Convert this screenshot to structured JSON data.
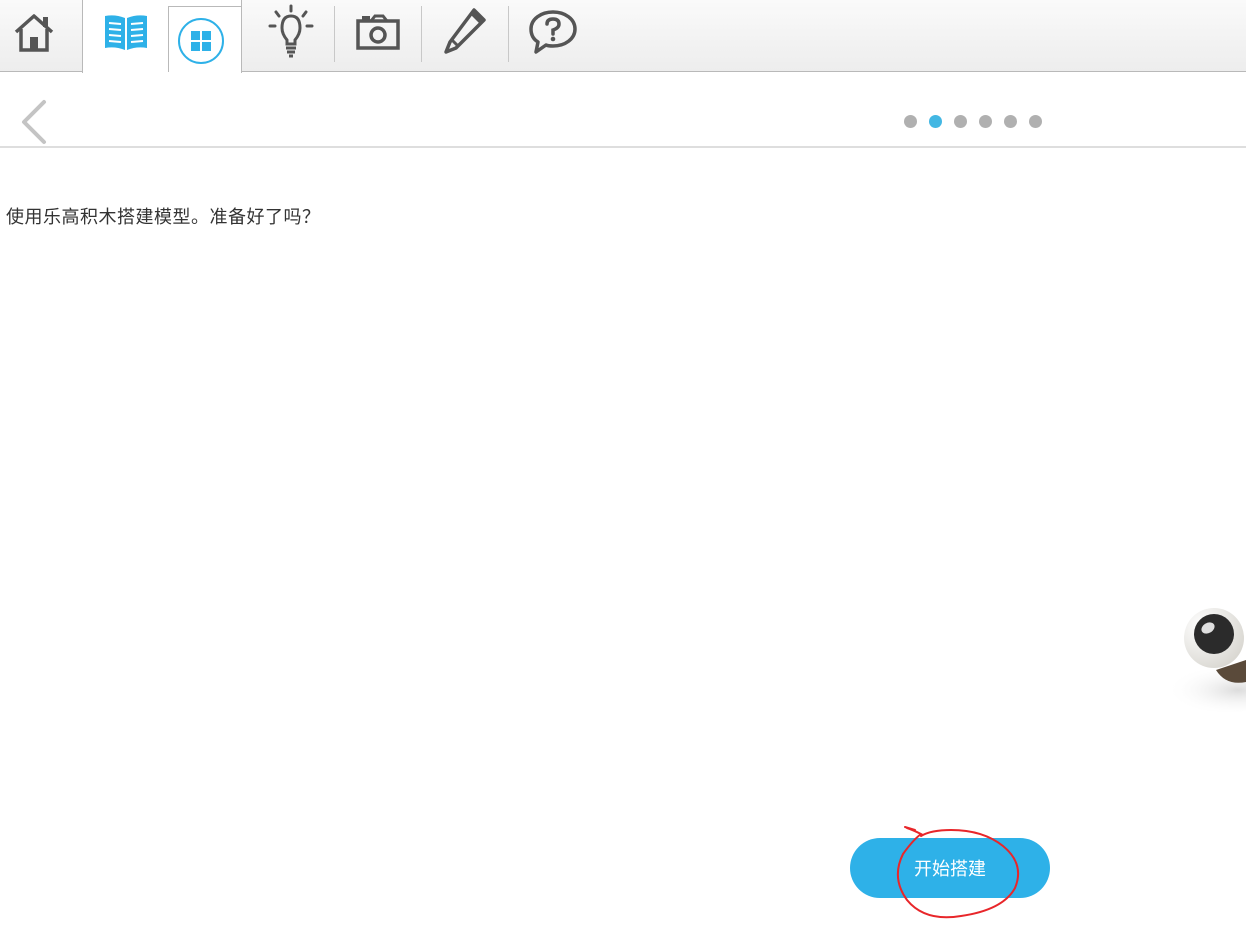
{
  "toolbar": {
    "tools": [
      {
        "name": "home-icon"
      },
      {
        "name": "book-icon"
      },
      {
        "name": "grid-icon"
      },
      {
        "name": "lightbulb-icon"
      },
      {
        "name": "camera-icon"
      },
      {
        "name": "pencil-icon"
      },
      {
        "name": "help-icon"
      }
    ],
    "accent": "#2eb1e8",
    "icon_color": "#555555"
  },
  "nav": {
    "back_icon": "chevron-left-icon",
    "page_count": 6,
    "current_page": 2
  },
  "content": {
    "prompt_text": "使用乐高积木搭建模型。准备好了吗？"
  },
  "actions": {
    "start_label": "开始搭建"
  }
}
